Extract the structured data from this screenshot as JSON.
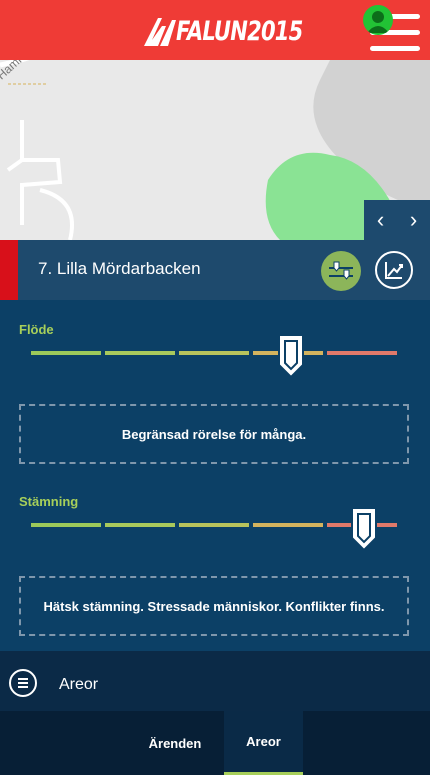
{
  "header": {
    "logo_text": "FALUN2015",
    "brand_color": "#ef3b36",
    "avatar_icon": "user-icon",
    "menu_icon": "hamburger-icon"
  },
  "map": {
    "road_label": "Hamravägen",
    "nav_prev": "‹",
    "nav_next": "›"
  },
  "area": {
    "title": "7. Lilla Mördarbacken",
    "flow_button_icon": "flow-icon",
    "chart_button_icon": "chart-icon"
  },
  "flow": {
    "label": "Flöde",
    "level": 0.71,
    "description": "Begränsad rörelse för många."
  },
  "mood": {
    "label": "Stämning",
    "level": 0.91,
    "description": "Hätsk stämning. Stressade människor. Konflikter finns."
  },
  "scale_colors": [
    "#9dc95a",
    "#a9c95c",
    "#b8c35c",
    "#d3b35e",
    "#e0796a"
  ],
  "list_row": {
    "label": "Areor"
  },
  "tabs": [
    {
      "label": "Ärenden",
      "active": false
    },
    {
      "label": "Areor",
      "active": true
    }
  ]
}
